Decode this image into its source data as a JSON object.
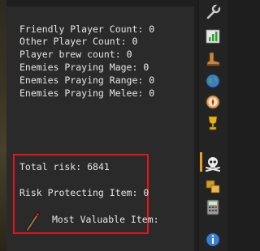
{
  "stats": [
    {
      "label": "Friendly Player Count:",
      "value": "0"
    },
    {
      "label": "Other Player Count:",
      "value": "0"
    },
    {
      "label": "Player brew count:",
      "value": "0"
    },
    {
      "label": "Enemies Praying Mage:",
      "value": "0"
    },
    {
      "label": "Enemies Praying Range:",
      "value": "0"
    },
    {
      "label": "Enemies Praying Melee:",
      "value": "0"
    }
  ],
  "risk": {
    "total_label": "Total risk:",
    "total_value": "6841",
    "protecting_label": "Risk Protecting Item:",
    "protecting_value": "0",
    "mvi_label": "Most Valuable Item:"
  },
  "sidebar_icons": [
    "wrench-icon",
    "chart-icon",
    "boot-icon",
    "globe-icon",
    "compass-icon",
    "trophy-icon",
    "skull-crossbones-icon",
    "swap-icon",
    "calculator-icon",
    "info-icon"
  ],
  "colors": {
    "highlight_border": "#e5141b",
    "active_marker": "#e8a024"
  }
}
